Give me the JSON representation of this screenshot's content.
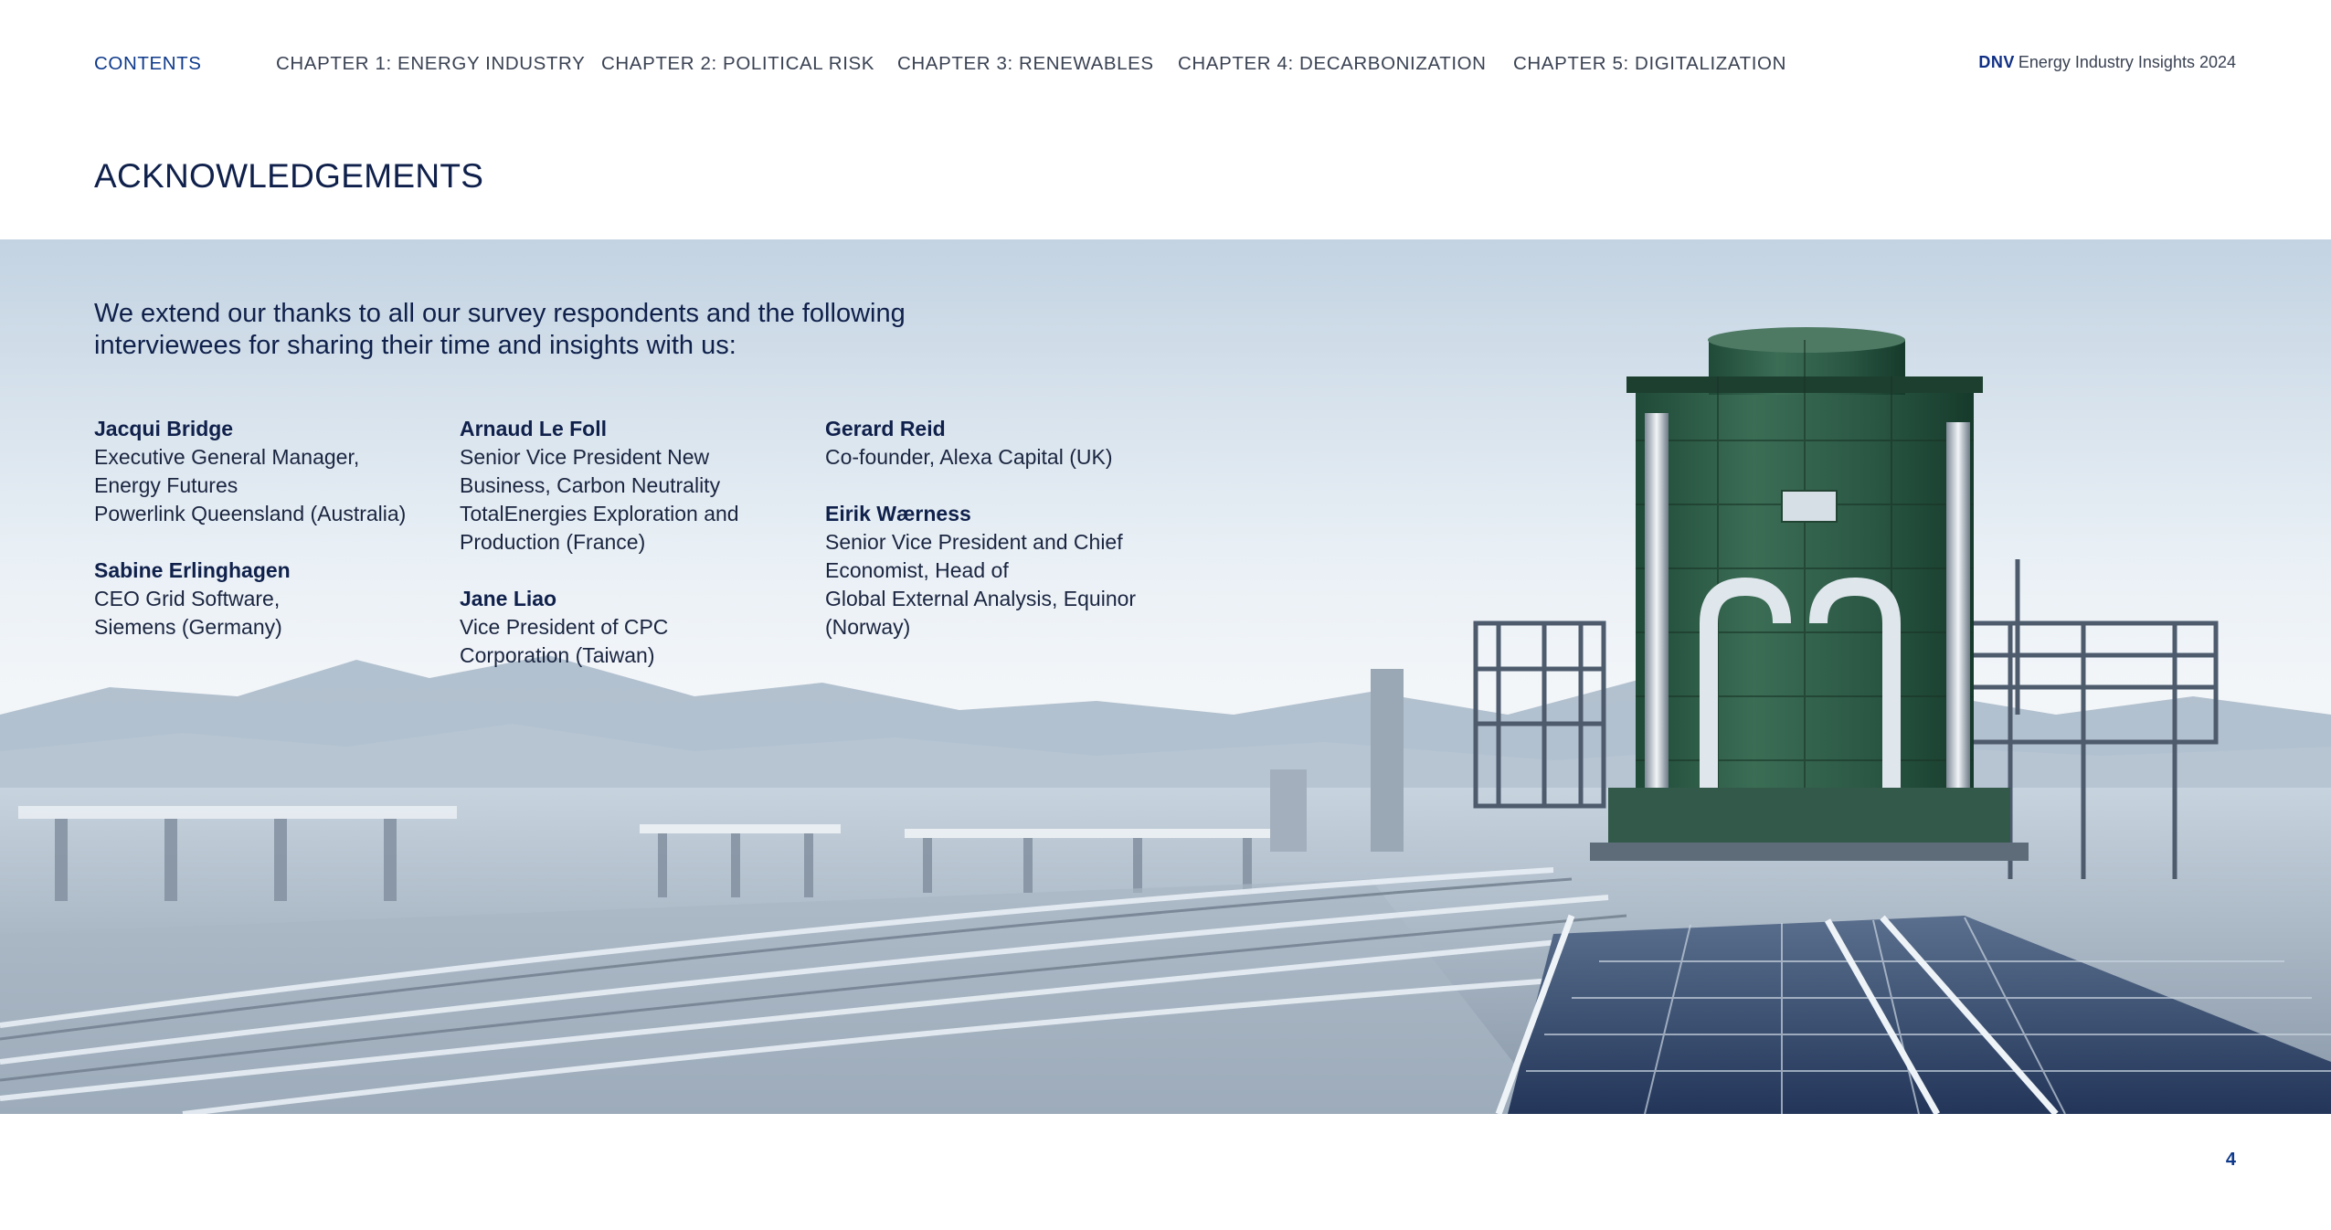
{
  "nav": {
    "contents": "CONTENTS",
    "chapters": [
      "CHAPTER 1: ENERGY INDUSTRY",
      "CHAPTER 2: POLITICAL RISK",
      "CHAPTER 3: RENEWABLES",
      "CHAPTER 4: DECARBONIZATION",
      "CHAPTER 5: DIGITALIZATION"
    ],
    "brand_logo": "DNV",
    "brand_text": "Energy Industry Insights 2024"
  },
  "page": {
    "title": "ACKNOWLEDGEMENTS",
    "intro": "We extend our thanks to all our survey respondents and the following interviewees for sharing their time and insights with us:",
    "page_number": "4"
  },
  "people": {
    "col1": [
      {
        "name": "Jacqui Bridge",
        "role": "Executive General Manager,\nEnergy Futures\nPowerlink Queensland (Australia)"
      },
      {
        "name": "Sabine Erlinghagen",
        "role": "CEO Grid Software,\nSiemens (Germany)"
      }
    ],
    "col2": [
      {
        "name": "Arnaud Le Foll",
        "role": "Senior Vice President New\nBusiness, Carbon Neutrality\nTotalEnergies Exploration and\nProduction (France)"
      },
      {
        "name": "Jane Liao",
        "role": "Vice President of CPC\nCorporation (Taiwan)"
      }
    ],
    "col3": [
      {
        "name": "Gerard Reid",
        "role": "Co-founder, Alexa Capital (UK)"
      },
      {
        "name": "Eirik Wærness",
        "role": "Senior Vice President and Chief\nEconomist, Head of\nGlobal External Analysis,  Equinor\n(Norway)"
      }
    ]
  }
}
